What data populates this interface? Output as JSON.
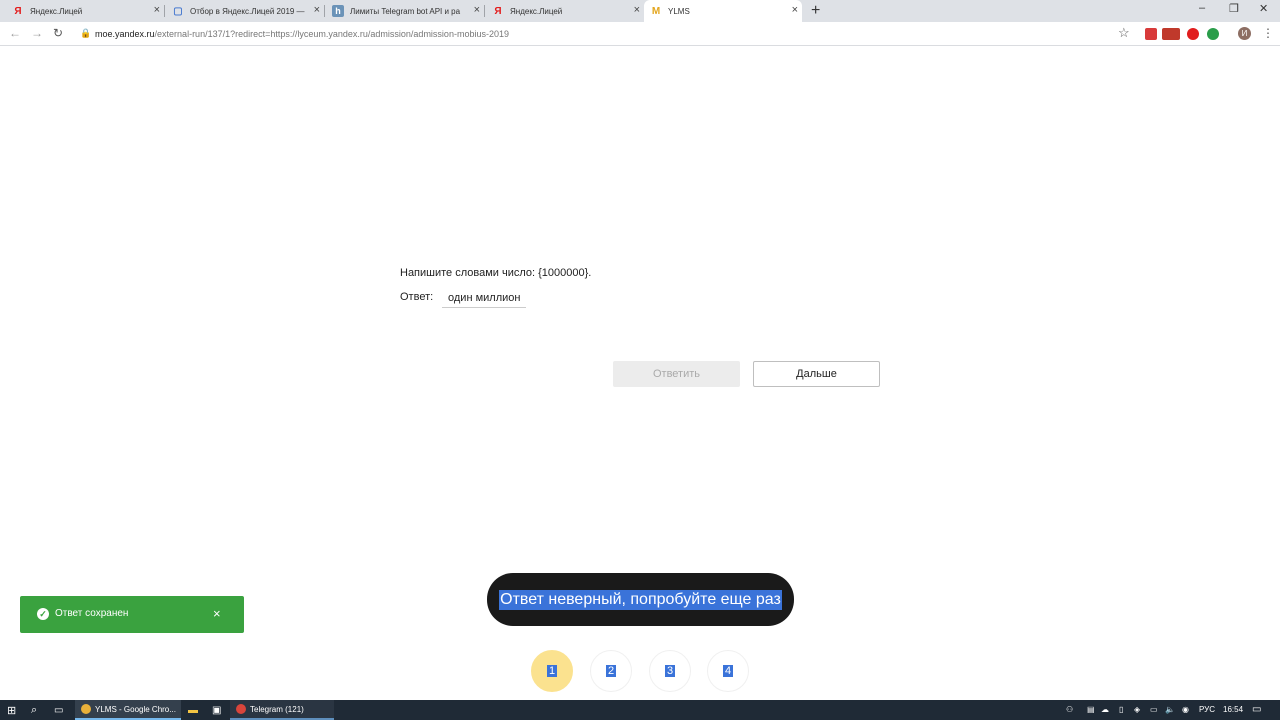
{
  "browser": {
    "tabs": [
      {
        "title": "Яндекс.Лицей",
        "icon": "yandex-icon"
      },
      {
        "title": "Отбор в Яндекс.Лицей 2019 —",
        "icon": "clipboard-icon"
      },
      {
        "title": "Лимиты Telegram bot API и ра",
        "icon": "habr-icon"
      },
      {
        "title": "Яндекс.Лицей",
        "icon": "yandex-icon"
      },
      {
        "title": "YLMS",
        "icon": "ylms-icon"
      }
    ],
    "url_host": "moe.yandex.ru",
    "url_path": "/external-run/137/1?redirect=https://lyceum.yandex.ru/admission/admission-mobius-2019",
    "profile_initial": "И"
  },
  "task": {
    "question": "Напишите словами число: {1000000}.",
    "answer_label": "Ответ:",
    "answer_value": "один миллион",
    "submit_label": "Ответить",
    "next_label": "Дальше"
  },
  "notices": {
    "result": "Ответ неверный, попробуйте еще раз",
    "saved": "Ответ сохранен"
  },
  "pagination": {
    "pages": [
      "1",
      "2",
      "3",
      "4"
    ],
    "current": "1"
  },
  "taskbar": {
    "apps": [
      {
        "label": "YLMS - Google Chro..."
      },
      {
        "label": "Telegram (121)"
      }
    ],
    "language": "РУС",
    "time": "16:54"
  },
  "colors": {
    "accent_green": "#3aa23f",
    "selection_blue": "#3a73d9",
    "current_page": "#fbe28f"
  }
}
